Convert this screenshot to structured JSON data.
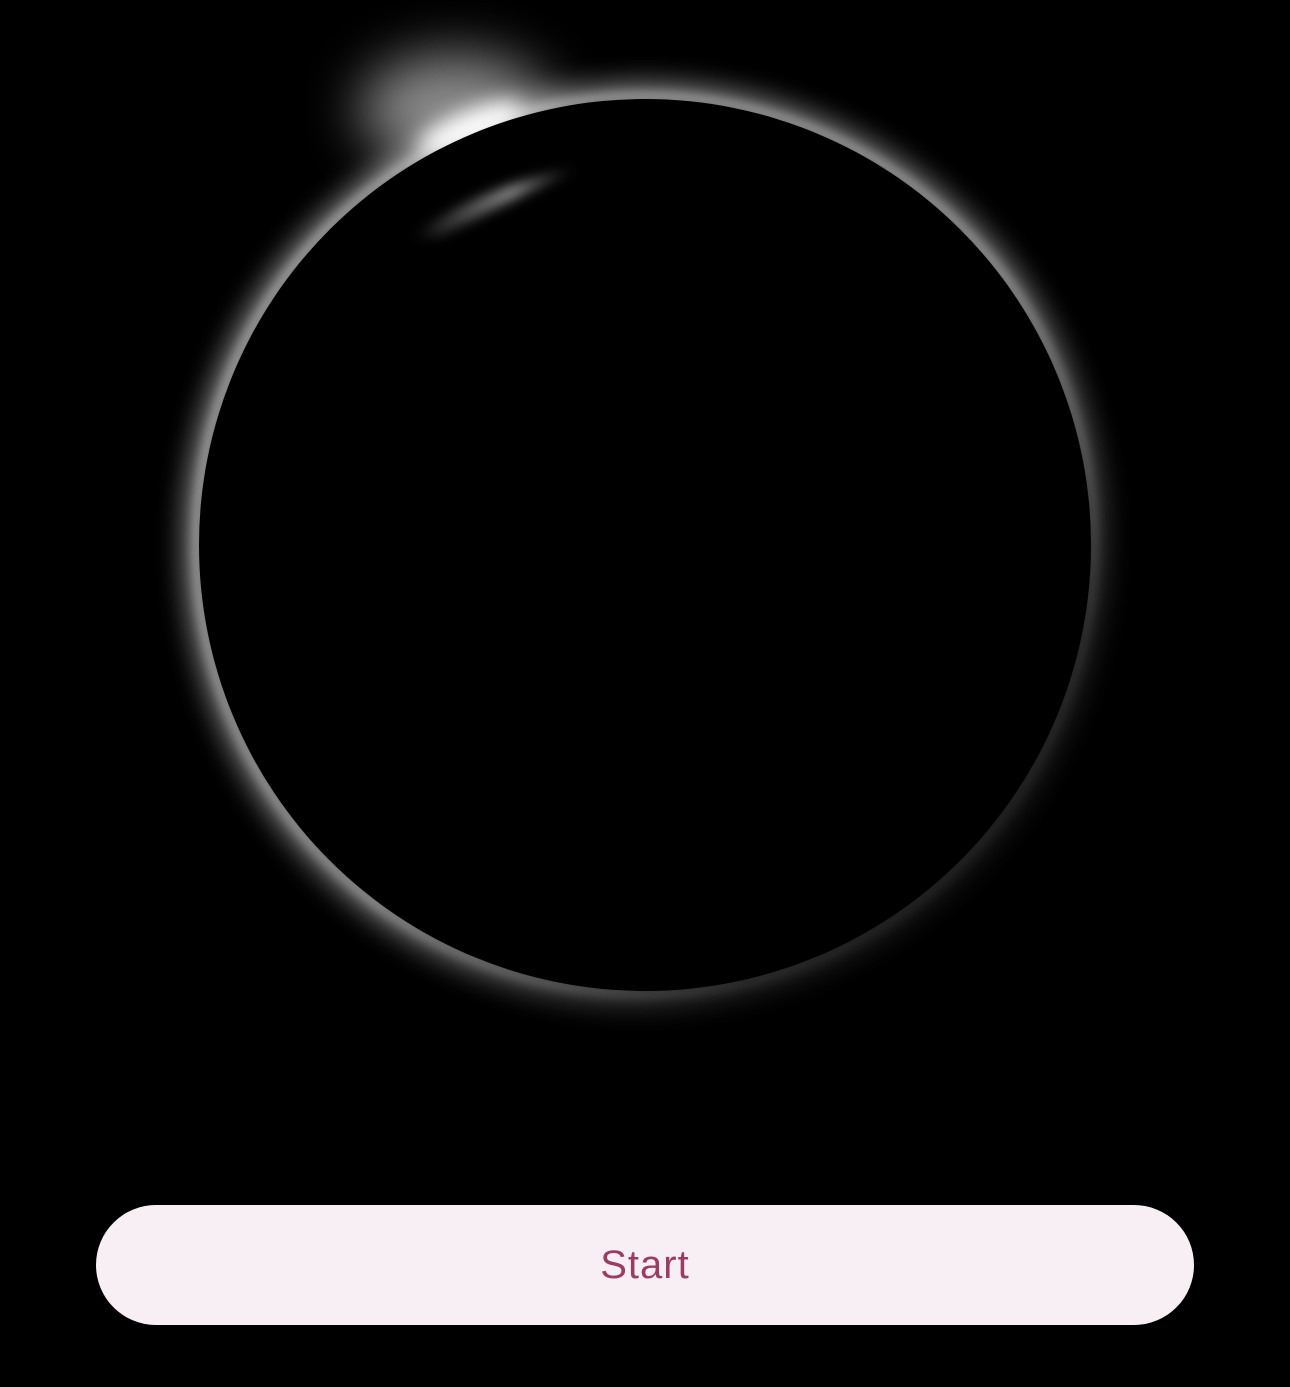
{
  "start_button": {
    "label": "Start"
  },
  "colors": {
    "background": "#000000",
    "button_bg": "#f8eff4",
    "button_text": "#9a3d63",
    "corona": "#ffffff"
  },
  "icons": {
    "eclipse": "solar-eclipse-icon"
  }
}
